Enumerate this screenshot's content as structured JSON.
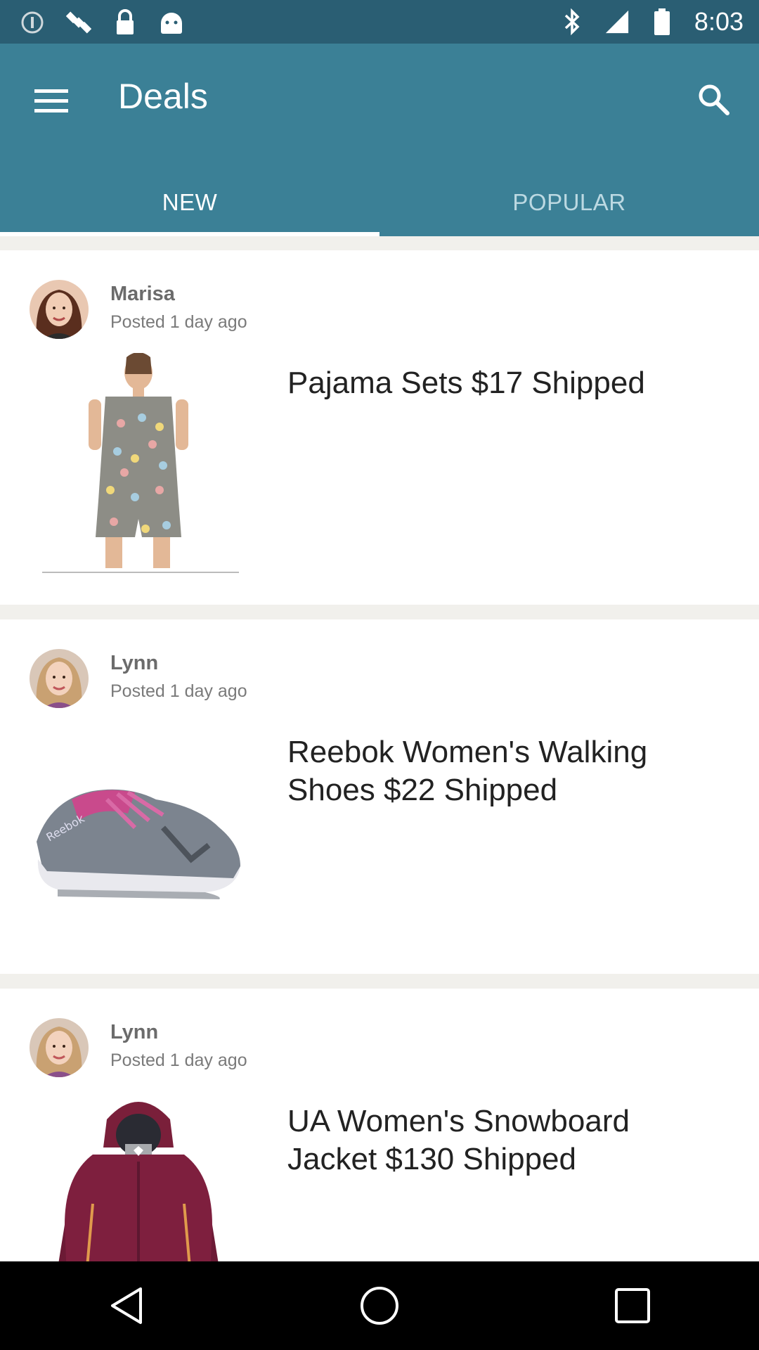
{
  "status_bar": {
    "time": "8:03",
    "icons": [
      "notification-icon",
      "satellite-icon",
      "lock-icon",
      "android-icon",
      "bluetooth-icon",
      "signal-icon",
      "battery-icon"
    ]
  },
  "app_bar": {
    "title": "Deals",
    "menu_icon": "menu-icon",
    "search_icon": "search-icon",
    "accent_color": "#3b8096",
    "status_color": "#2a5e73"
  },
  "tabs": [
    {
      "label": "NEW",
      "active": true
    },
    {
      "label": "POPULAR",
      "active": false
    }
  ],
  "deals": [
    {
      "author": "Marisa",
      "posted": "Posted 1 day ago",
      "title": "Pajama Sets $17 Shipped",
      "image": "pajama-set-image"
    },
    {
      "author": "Lynn",
      "posted": "Posted 1 day ago",
      "title": "Reebok Women's Walking Shoes $22 Shipped",
      "image": "walking-shoe-image"
    },
    {
      "author": "Lynn",
      "posted": "Posted 1 day ago",
      "title": "UA Women's Snowboard Jacket $130 Shipped",
      "image": "snowboard-jacket-image"
    }
  ],
  "nav_bar": {
    "buttons": [
      "back-icon",
      "home-icon",
      "recents-icon"
    ]
  }
}
